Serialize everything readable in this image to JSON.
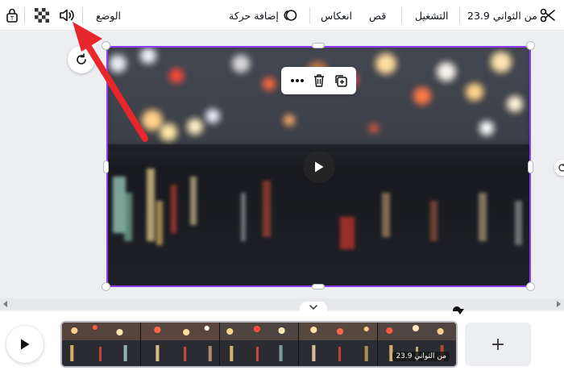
{
  "toolbar": {
    "duration_label": "23.9 من الثواني",
    "play_label": "التشغيل",
    "crop_label": "قص",
    "flip_label": "انعكاس",
    "add_animation_label": "إضافة حركة",
    "position_label": "الوضع"
  },
  "timeline": {
    "clip_duration": "23.9 من الثواني",
    "add_label": "+"
  },
  "colors": {
    "selection": "#8b3dff",
    "annotation_arrow": "#e8262b"
  },
  "icons": {
    "scissors": "scissors-icon",
    "animation": "animation-icon",
    "volume": "volume-icon",
    "transparency": "transparency-icon",
    "lock": "lock-icon",
    "more": "more-icon",
    "delete": "trash-icon",
    "duplicate": "duplicate-icon",
    "play": "play-icon",
    "rotate": "rotate-icon"
  }
}
